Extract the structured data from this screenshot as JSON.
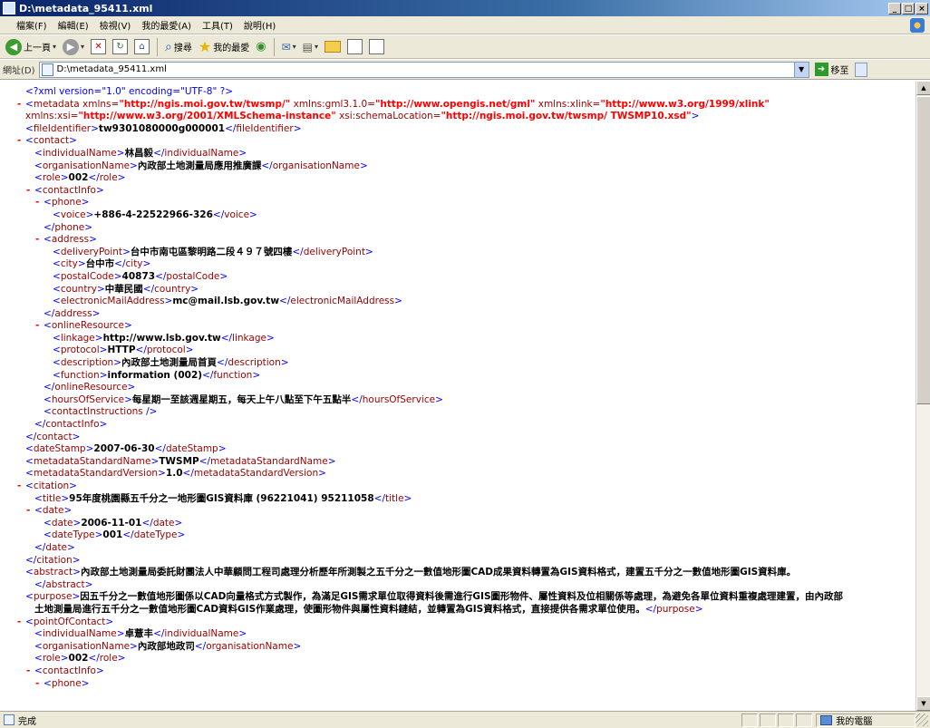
{
  "window": {
    "title": "D:\\metadata_95411.xml",
    "min": "_",
    "max": "□",
    "close": "×"
  },
  "menu": [
    "檔案(F)",
    "編輯(E)",
    "檢視(V)",
    "我的最愛(A)",
    "工具(T)",
    "說明(H)"
  ],
  "toolbar": {
    "back_label": "上一頁",
    "search_label": "搜尋",
    "favorites_label": "我的最愛",
    "back_glyph": "◀",
    "fwd_glyph": "▶",
    "stop_glyph": "✕",
    "refresh_glyph": "↻",
    "home_glyph": "⌂",
    "search_glyph": "⌕",
    "star_glyph": "★",
    "media_glyph": "◉",
    "mail_glyph": "✉",
    "print_glyph": "▤",
    "caret": "▾"
  },
  "address": {
    "label": "網址(D)",
    "value": "D:\\metadata_95411.xml",
    "drop": "▼",
    "go_label": "移至",
    "go_glyph": "➜"
  },
  "xml_lines": [
    [
      1,
      "",
      [
        [
          "pi",
          "<?xml version=\"1.0\" encoding=\"UTF-8\" ?>"
        ]
      ]
    ],
    [
      0,
      "-",
      [
        [
          "b",
          "<"
        ],
        [
          "t",
          "metadata"
        ],
        [
          "an",
          " xmlns="
        ],
        [
          "av",
          "\"http://ngis.moi.gov.tw/twsmp/\""
        ],
        [
          "an",
          " xmlns:gml3.1.0="
        ],
        [
          "av",
          "\"http://www.opengis.net/gml\""
        ],
        [
          "an",
          " xmlns:xlink="
        ],
        [
          "av",
          "\"http://www.w3.org/1999/xlink\""
        ]
      ]
    ],
    [
      1,
      "",
      [
        [
          "an",
          "xmlns:xsi="
        ],
        [
          "av",
          "\"http://www.w3.org/2001/XMLSchema-instance\""
        ],
        [
          "an",
          " xsi:schemaLocation="
        ],
        [
          "av",
          "\"http://ngis.moi.gov.tw/twsmp/ TWSMP10.xsd\""
        ],
        [
          "b",
          ">"
        ]
      ]
    ],
    [
      1,
      "",
      [
        [
          "b",
          "<"
        ],
        [
          "t",
          "fileIdentifier"
        ],
        [
          "b",
          ">"
        ],
        [
          "tx",
          "tw9301080000g000001"
        ],
        [
          "b",
          "</"
        ],
        [
          "t",
          "fileIdentifier"
        ],
        [
          "b",
          ">"
        ]
      ]
    ],
    [
      0,
      "-",
      [
        [
          "b",
          "<"
        ],
        [
          "t",
          "contact"
        ],
        [
          "b",
          ">"
        ]
      ]
    ],
    [
      2,
      "",
      [
        [
          "b",
          "<"
        ],
        [
          "t",
          "individualName"
        ],
        [
          "b",
          ">"
        ],
        [
          "tx",
          "林昌毅"
        ],
        [
          "b",
          "</"
        ],
        [
          "t",
          "individualName"
        ],
        [
          "b",
          ">"
        ]
      ]
    ],
    [
      2,
      "",
      [
        [
          "b",
          "<"
        ],
        [
          "t",
          "organisationName"
        ],
        [
          "b",
          ">"
        ],
        [
          "tx",
          "內政部土地測量局應用推廣課"
        ],
        [
          "b",
          "</"
        ],
        [
          "t",
          "organisationName"
        ],
        [
          "b",
          ">"
        ]
      ]
    ],
    [
      2,
      "",
      [
        [
          "b",
          "<"
        ],
        [
          "t",
          "role"
        ],
        [
          "b",
          ">"
        ],
        [
          "tx",
          "002"
        ],
        [
          "b",
          "</"
        ],
        [
          "t",
          "role"
        ],
        [
          "b",
          ">"
        ]
      ]
    ],
    [
      1,
      "-",
      [
        [
          "b",
          "<"
        ],
        [
          "t",
          "contactInfo"
        ],
        [
          "b",
          ">"
        ]
      ]
    ],
    [
      2,
      "-",
      [
        [
          "b",
          "<"
        ],
        [
          "t",
          "phone"
        ],
        [
          "b",
          ">"
        ]
      ]
    ],
    [
      4,
      "",
      [
        [
          "b",
          "<"
        ],
        [
          "t",
          "voice"
        ],
        [
          "b",
          ">"
        ],
        [
          "tx",
          "+886-4-22522966-326"
        ],
        [
          "b",
          "</"
        ],
        [
          "t",
          "voice"
        ],
        [
          "b",
          ">"
        ]
      ]
    ],
    [
      3,
      "",
      [
        [
          "b",
          "</"
        ],
        [
          "t",
          "phone"
        ],
        [
          "b",
          ">"
        ]
      ]
    ],
    [
      2,
      "-",
      [
        [
          "b",
          "<"
        ],
        [
          "t",
          "address"
        ],
        [
          "b",
          ">"
        ]
      ]
    ],
    [
      4,
      "",
      [
        [
          "b",
          "<"
        ],
        [
          "t",
          "deliveryPoint"
        ],
        [
          "b",
          ">"
        ],
        [
          "tx",
          "台中市南屯區黎明路二段４９７號四樓"
        ],
        [
          "b",
          "</"
        ],
        [
          "t",
          "deliveryPoint"
        ],
        [
          "b",
          ">"
        ]
      ]
    ],
    [
      4,
      "",
      [
        [
          "b",
          "<"
        ],
        [
          "t",
          "city"
        ],
        [
          "b",
          ">"
        ],
        [
          "tx",
          "台中市"
        ],
        [
          "b",
          "</"
        ],
        [
          "t",
          "city"
        ],
        [
          "b",
          ">"
        ]
      ]
    ],
    [
      4,
      "",
      [
        [
          "b",
          "<"
        ],
        [
          "t",
          "postalCode"
        ],
        [
          "b",
          ">"
        ],
        [
          "tx",
          "40873"
        ],
        [
          "b",
          "</"
        ],
        [
          "t",
          "postalCode"
        ],
        [
          "b",
          ">"
        ]
      ]
    ],
    [
      4,
      "",
      [
        [
          "b",
          "<"
        ],
        [
          "t",
          "country"
        ],
        [
          "b",
          ">"
        ],
        [
          "tx",
          "中華民國"
        ],
        [
          "b",
          "</"
        ],
        [
          "t",
          "country"
        ],
        [
          "b",
          ">"
        ]
      ]
    ],
    [
      4,
      "",
      [
        [
          "b",
          "<"
        ],
        [
          "t",
          "electronicMailAddress"
        ],
        [
          "b",
          ">"
        ],
        [
          "tx",
          "mc@mail.lsb.gov.tw"
        ],
        [
          "b",
          "</"
        ],
        [
          "t",
          "electronicMailAddress"
        ],
        [
          "b",
          ">"
        ]
      ]
    ],
    [
      3,
      "",
      [
        [
          "b",
          "</"
        ],
        [
          "t",
          "address"
        ],
        [
          "b",
          ">"
        ]
      ]
    ],
    [
      2,
      "-",
      [
        [
          "b",
          "<"
        ],
        [
          "t",
          "onlineResource"
        ],
        [
          "b",
          ">"
        ]
      ]
    ],
    [
      4,
      "",
      [
        [
          "b",
          "<"
        ],
        [
          "t",
          "linkage"
        ],
        [
          "b",
          ">"
        ],
        [
          "tx",
          "http://www.lsb.gov.tw"
        ],
        [
          "b",
          "</"
        ],
        [
          "t",
          "linkage"
        ],
        [
          "b",
          ">"
        ]
      ]
    ],
    [
      4,
      "",
      [
        [
          "b",
          "<"
        ],
        [
          "t",
          "protocol"
        ],
        [
          "b",
          ">"
        ],
        [
          "tx",
          "HTTP"
        ],
        [
          "b",
          "</"
        ],
        [
          "t",
          "protocol"
        ],
        [
          "b",
          ">"
        ]
      ]
    ],
    [
      4,
      "",
      [
        [
          "b",
          "<"
        ],
        [
          "t",
          "description"
        ],
        [
          "b",
          ">"
        ],
        [
          "tx",
          "內政部土地測量局首頁"
        ],
        [
          "b",
          "</"
        ],
        [
          "t",
          "description"
        ],
        [
          "b",
          ">"
        ]
      ]
    ],
    [
      4,
      "",
      [
        [
          "b",
          "<"
        ],
        [
          "t",
          "function"
        ],
        [
          "b",
          ">"
        ],
        [
          "tx",
          "information (002)"
        ],
        [
          "b",
          "</"
        ],
        [
          "t",
          "function"
        ],
        [
          "b",
          ">"
        ]
      ]
    ],
    [
      3,
      "",
      [
        [
          "b",
          "</"
        ],
        [
          "t",
          "onlineResource"
        ],
        [
          "b",
          ">"
        ]
      ]
    ],
    [
      3,
      "",
      [
        [
          "b",
          "<"
        ],
        [
          "t",
          "hoursOfService"
        ],
        [
          "b",
          ">"
        ],
        [
          "tx",
          "每星期一至該週星期五，每天上午八點至下午五點半"
        ],
        [
          "b",
          "</"
        ],
        [
          "t",
          "hoursOfService"
        ],
        [
          "b",
          ">"
        ]
      ]
    ],
    [
      3,
      "",
      [
        [
          "b",
          "<"
        ],
        [
          "t",
          "contactInstructions"
        ],
        [
          "b",
          " />"
        ]
      ]
    ],
    [
      2,
      "",
      [
        [
          "b",
          "</"
        ],
        [
          "t",
          "contactInfo"
        ],
        [
          "b",
          ">"
        ]
      ]
    ],
    [
      1,
      "",
      [
        [
          "b",
          "</"
        ],
        [
          "t",
          "contact"
        ],
        [
          "b",
          ">"
        ]
      ]
    ],
    [
      1,
      "",
      [
        [
          "b",
          "<"
        ],
        [
          "t",
          "dateStamp"
        ],
        [
          "b",
          ">"
        ],
        [
          "tx",
          "2007-06-30"
        ],
        [
          "b",
          "</"
        ],
        [
          "t",
          "dateStamp"
        ],
        [
          "b",
          ">"
        ]
      ]
    ],
    [
      1,
      "",
      [
        [
          "b",
          "<"
        ],
        [
          "t",
          "metadataStandardName"
        ],
        [
          "b",
          ">"
        ],
        [
          "tx",
          "TWSMP"
        ],
        [
          "b",
          "</"
        ],
        [
          "t",
          "metadataStandardName"
        ],
        [
          "b",
          ">"
        ]
      ]
    ],
    [
      1,
      "",
      [
        [
          "b",
          "<"
        ],
        [
          "t",
          "metadataStandardVersion"
        ],
        [
          "b",
          ">"
        ],
        [
          "tx",
          "1.0"
        ],
        [
          "b",
          "</"
        ],
        [
          "t",
          "metadataStandardVersion"
        ],
        [
          "b",
          ">"
        ]
      ]
    ],
    [
      0,
      "-",
      [
        [
          "b",
          "<"
        ],
        [
          "t",
          "citation"
        ],
        [
          "b",
          ">"
        ]
      ]
    ],
    [
      2,
      "",
      [
        [
          "b",
          "<"
        ],
        [
          "t",
          "title"
        ],
        [
          "b",
          ">"
        ],
        [
          "tx",
          "95年度桃園縣五千分之一地形圖GIS資料庫 (96221041)  95211058"
        ],
        [
          "b",
          "</"
        ],
        [
          "t",
          "title"
        ],
        [
          "b",
          ">"
        ]
      ]
    ],
    [
      1,
      "-",
      [
        [
          "b",
          "<"
        ],
        [
          "t",
          "date"
        ],
        [
          "b",
          ">"
        ]
      ]
    ],
    [
      3,
      "",
      [
        [
          "b",
          "<"
        ],
        [
          "t",
          "date"
        ],
        [
          "b",
          ">"
        ],
        [
          "tx",
          "2006-11-01"
        ],
        [
          "b",
          "</"
        ],
        [
          "t",
          "date"
        ],
        [
          "b",
          ">"
        ]
      ]
    ],
    [
      3,
      "",
      [
        [
          "b",
          "<"
        ],
        [
          "t",
          "dateType"
        ],
        [
          "b",
          ">"
        ],
        [
          "tx",
          "001"
        ],
        [
          "b",
          "</"
        ],
        [
          "t",
          "dateType"
        ],
        [
          "b",
          ">"
        ]
      ]
    ],
    [
      2,
      "",
      [
        [
          "b",
          "</"
        ],
        [
          "t",
          "date"
        ],
        [
          "b",
          ">"
        ]
      ]
    ],
    [
      1,
      "",
      [
        [
          "b",
          "</"
        ],
        [
          "t",
          "citation"
        ],
        [
          "b",
          ">"
        ]
      ]
    ],
    [
      1,
      "",
      [
        [
          "b",
          "<"
        ],
        [
          "t",
          "abstract"
        ],
        [
          "b",
          ">"
        ],
        [
          "tx",
          "內政部土地測量局委託財團法人中華顧問工程司處理分析歷年所測製之五千分之一數值地形圖CAD成果資料轉置為GIS資料格式，建置五千分之一數值地形圖GIS資料庫。"
        ]
      ]
    ],
    [
      2,
      "",
      [
        [
          "b",
          "</"
        ],
        [
          "t",
          "abstract"
        ],
        [
          "b",
          ">"
        ]
      ]
    ],
    [
      1,
      "",
      [
        [
          "b",
          "<"
        ],
        [
          "t",
          "purpose"
        ],
        [
          "b",
          ">"
        ],
        [
          "tx",
          "因五千分之一數值地形圖係以CAD向量格式方式製作，為滿足GIS需求單位取得資料後需進行GIS圖形物件、屬性資料及位相關係等處理，為避免各單位資料重複處理建置，由內政部"
        ]
      ]
    ],
    [
      2,
      "",
      [
        [
          "tx",
          "土地測量局進行五千分之一數值地形圖CAD資料GIS作業處理，使圖形物件與屬性資料鏈結，並轉置為GIS資料格式，直接提供各需求單位使用。"
        ],
        [
          "b",
          "</"
        ],
        [
          "t",
          "purpose"
        ],
        [
          "b",
          ">"
        ]
      ]
    ],
    [
      0,
      "-",
      [
        [
          "b",
          "<"
        ],
        [
          "t",
          "pointOfContact"
        ],
        [
          "b",
          ">"
        ]
      ]
    ],
    [
      2,
      "",
      [
        [
          "b",
          "<"
        ],
        [
          "t",
          "individualName"
        ],
        [
          "b",
          ">"
        ],
        [
          "tx",
          "卓薏丰"
        ],
        [
          "b",
          "</"
        ],
        [
          "t",
          "individualName"
        ],
        [
          "b",
          ">"
        ]
      ]
    ],
    [
      2,
      "",
      [
        [
          "b",
          "<"
        ],
        [
          "t",
          "organisationName"
        ],
        [
          "b",
          ">"
        ],
        [
          "tx",
          "內政部地政司"
        ],
        [
          "b",
          "</"
        ],
        [
          "t",
          "organisationName"
        ],
        [
          "b",
          ">"
        ]
      ]
    ],
    [
      2,
      "",
      [
        [
          "b",
          "<"
        ],
        [
          "t",
          "role"
        ],
        [
          "b",
          ">"
        ],
        [
          "tx",
          "002"
        ],
        [
          "b",
          "</"
        ],
        [
          "t",
          "role"
        ],
        [
          "b",
          ">"
        ]
      ]
    ],
    [
      1,
      "-",
      [
        [
          "b",
          "<"
        ],
        [
          "t",
          "contactInfo"
        ],
        [
          "b",
          ">"
        ]
      ]
    ],
    [
      2,
      "-",
      [
        [
          "b",
          "<"
        ],
        [
          "t",
          "phone"
        ],
        [
          "b",
          ">"
        ]
      ]
    ]
  ],
  "status": {
    "text": "完成",
    "zone": "我的電腦"
  }
}
